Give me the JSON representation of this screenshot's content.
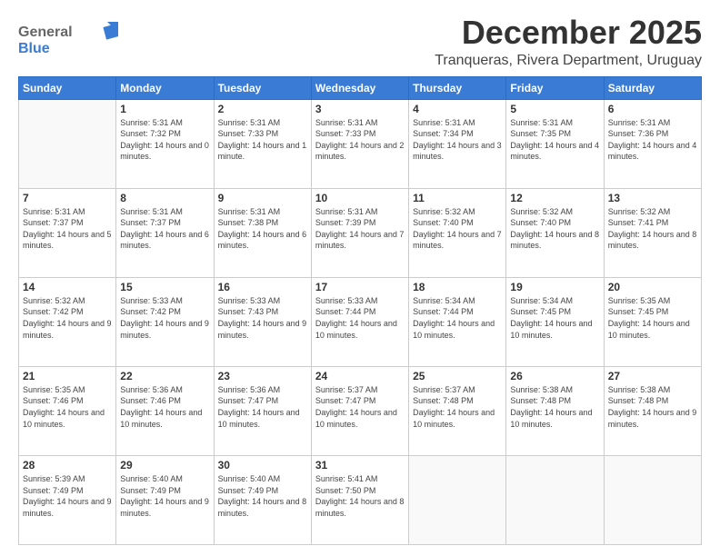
{
  "header": {
    "logo": {
      "general": "General",
      "blue": "Blue"
    },
    "month": "December 2025",
    "location": "Tranqueras, Rivera Department, Uruguay"
  },
  "days_of_week": [
    "Sunday",
    "Monday",
    "Tuesday",
    "Wednesday",
    "Thursday",
    "Friday",
    "Saturday"
  ],
  "weeks": [
    [
      {
        "day": "",
        "sunrise": "",
        "sunset": "",
        "daylight": ""
      },
      {
        "day": "1",
        "sunrise": "Sunrise: 5:31 AM",
        "sunset": "Sunset: 7:32 PM",
        "daylight": "Daylight: 14 hours and 0 minutes."
      },
      {
        "day": "2",
        "sunrise": "Sunrise: 5:31 AM",
        "sunset": "Sunset: 7:33 PM",
        "daylight": "Daylight: 14 hours and 1 minute."
      },
      {
        "day": "3",
        "sunrise": "Sunrise: 5:31 AM",
        "sunset": "Sunset: 7:33 PM",
        "daylight": "Daylight: 14 hours and 2 minutes."
      },
      {
        "day": "4",
        "sunrise": "Sunrise: 5:31 AM",
        "sunset": "Sunset: 7:34 PM",
        "daylight": "Daylight: 14 hours and 3 minutes."
      },
      {
        "day": "5",
        "sunrise": "Sunrise: 5:31 AM",
        "sunset": "Sunset: 7:35 PM",
        "daylight": "Daylight: 14 hours and 4 minutes."
      },
      {
        "day": "6",
        "sunrise": "Sunrise: 5:31 AM",
        "sunset": "Sunset: 7:36 PM",
        "daylight": "Daylight: 14 hours and 4 minutes."
      }
    ],
    [
      {
        "day": "7",
        "sunrise": "Sunrise: 5:31 AM",
        "sunset": "Sunset: 7:37 PM",
        "daylight": "Daylight: 14 hours and 5 minutes."
      },
      {
        "day": "8",
        "sunrise": "Sunrise: 5:31 AM",
        "sunset": "Sunset: 7:37 PM",
        "daylight": "Daylight: 14 hours and 6 minutes."
      },
      {
        "day": "9",
        "sunrise": "Sunrise: 5:31 AM",
        "sunset": "Sunset: 7:38 PM",
        "daylight": "Daylight: 14 hours and 6 minutes."
      },
      {
        "day": "10",
        "sunrise": "Sunrise: 5:31 AM",
        "sunset": "Sunset: 7:39 PM",
        "daylight": "Daylight: 14 hours and 7 minutes."
      },
      {
        "day": "11",
        "sunrise": "Sunrise: 5:32 AM",
        "sunset": "Sunset: 7:40 PM",
        "daylight": "Daylight: 14 hours and 7 minutes."
      },
      {
        "day": "12",
        "sunrise": "Sunrise: 5:32 AM",
        "sunset": "Sunset: 7:40 PM",
        "daylight": "Daylight: 14 hours and 8 minutes."
      },
      {
        "day": "13",
        "sunrise": "Sunrise: 5:32 AM",
        "sunset": "Sunset: 7:41 PM",
        "daylight": "Daylight: 14 hours and 8 minutes."
      }
    ],
    [
      {
        "day": "14",
        "sunrise": "Sunrise: 5:32 AM",
        "sunset": "Sunset: 7:42 PM",
        "daylight": "Daylight: 14 hours and 9 minutes."
      },
      {
        "day": "15",
        "sunrise": "Sunrise: 5:33 AM",
        "sunset": "Sunset: 7:42 PM",
        "daylight": "Daylight: 14 hours and 9 minutes."
      },
      {
        "day": "16",
        "sunrise": "Sunrise: 5:33 AM",
        "sunset": "Sunset: 7:43 PM",
        "daylight": "Daylight: 14 hours and 9 minutes."
      },
      {
        "day": "17",
        "sunrise": "Sunrise: 5:33 AM",
        "sunset": "Sunset: 7:44 PM",
        "daylight": "Daylight: 14 hours and 10 minutes."
      },
      {
        "day": "18",
        "sunrise": "Sunrise: 5:34 AM",
        "sunset": "Sunset: 7:44 PM",
        "daylight": "Daylight: 14 hours and 10 minutes."
      },
      {
        "day": "19",
        "sunrise": "Sunrise: 5:34 AM",
        "sunset": "Sunset: 7:45 PM",
        "daylight": "Daylight: 14 hours and 10 minutes."
      },
      {
        "day": "20",
        "sunrise": "Sunrise: 5:35 AM",
        "sunset": "Sunset: 7:45 PM",
        "daylight": "Daylight: 14 hours and 10 minutes."
      }
    ],
    [
      {
        "day": "21",
        "sunrise": "Sunrise: 5:35 AM",
        "sunset": "Sunset: 7:46 PM",
        "daylight": "Daylight: 14 hours and 10 minutes."
      },
      {
        "day": "22",
        "sunrise": "Sunrise: 5:36 AM",
        "sunset": "Sunset: 7:46 PM",
        "daylight": "Daylight: 14 hours and 10 minutes."
      },
      {
        "day": "23",
        "sunrise": "Sunrise: 5:36 AM",
        "sunset": "Sunset: 7:47 PM",
        "daylight": "Daylight: 14 hours and 10 minutes."
      },
      {
        "day": "24",
        "sunrise": "Sunrise: 5:37 AM",
        "sunset": "Sunset: 7:47 PM",
        "daylight": "Daylight: 14 hours and 10 minutes."
      },
      {
        "day": "25",
        "sunrise": "Sunrise: 5:37 AM",
        "sunset": "Sunset: 7:48 PM",
        "daylight": "Daylight: 14 hours and 10 minutes."
      },
      {
        "day": "26",
        "sunrise": "Sunrise: 5:38 AM",
        "sunset": "Sunset: 7:48 PM",
        "daylight": "Daylight: 14 hours and 10 minutes."
      },
      {
        "day": "27",
        "sunrise": "Sunrise: 5:38 AM",
        "sunset": "Sunset: 7:48 PM",
        "daylight": "Daylight: 14 hours and 9 minutes."
      }
    ],
    [
      {
        "day": "28",
        "sunrise": "Sunrise: 5:39 AM",
        "sunset": "Sunset: 7:49 PM",
        "daylight": "Daylight: 14 hours and 9 minutes."
      },
      {
        "day": "29",
        "sunrise": "Sunrise: 5:40 AM",
        "sunset": "Sunset: 7:49 PM",
        "daylight": "Daylight: 14 hours and 9 minutes."
      },
      {
        "day": "30",
        "sunrise": "Sunrise: 5:40 AM",
        "sunset": "Sunset: 7:49 PM",
        "daylight": "Daylight: 14 hours and 8 minutes."
      },
      {
        "day": "31",
        "sunrise": "Sunrise: 5:41 AM",
        "sunset": "Sunset: 7:50 PM",
        "daylight": "Daylight: 14 hours and 8 minutes."
      },
      {
        "day": "",
        "sunrise": "",
        "sunset": "",
        "daylight": ""
      },
      {
        "day": "",
        "sunrise": "",
        "sunset": "",
        "daylight": ""
      },
      {
        "day": "",
        "sunrise": "",
        "sunset": "",
        "daylight": ""
      }
    ]
  ]
}
